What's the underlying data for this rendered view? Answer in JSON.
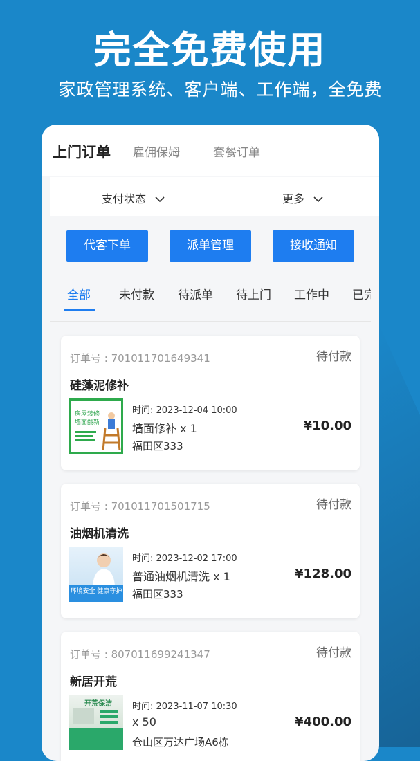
{
  "promo": {
    "headline": "完全免费使用",
    "subline": "家政管理系统、客户端、工作端，全免费"
  },
  "top_tabs": [
    "上门订单",
    "雇佣保姆",
    "套餐订单"
  ],
  "filters": {
    "payment_status": "支付状态",
    "more": "更多"
  },
  "actions": {
    "proxy_order": "代客下单",
    "dispatch": "派单管理",
    "notify": "接收通知"
  },
  "status_tabs": [
    "全部",
    "未付款",
    "待派单",
    "待上门",
    "工作中",
    "已完成"
  ],
  "orders": [
    {
      "order_no": "订单号 : 701011701649341",
      "status": "待付款",
      "service": "硅藻泥修补",
      "time": "时间:  2023-12-04 10:00",
      "item": "墙面修补 x 1",
      "address": "福田区333",
      "price": "¥10.00",
      "thumb_lines": [
        "房屋装修",
        "墙面翻新"
      ]
    },
    {
      "order_no": "订单号 : 701011701501715",
      "status": "待付款",
      "service": "油烟机清洗",
      "time": "时间:  2023-12-02 17:00",
      "item": "普通油烟机清洗 x 1",
      "address": "福田区333",
      "price": "¥128.00",
      "thumb_lines": [
        "环境安全 健康守护"
      ]
    },
    {
      "order_no": "订单号 : 807011699241347",
      "status": "待付款",
      "service": "新居开荒",
      "time": "时间:  2023-11-07 10:30",
      "item": "x 50",
      "address": "仓山区万达广场A6栋",
      "price": "¥400.00",
      "thumb_lines": [
        "开荒保洁"
      ]
    }
  ],
  "colors": {
    "bg": "#1a87c9",
    "accent": "#1e7df0"
  }
}
